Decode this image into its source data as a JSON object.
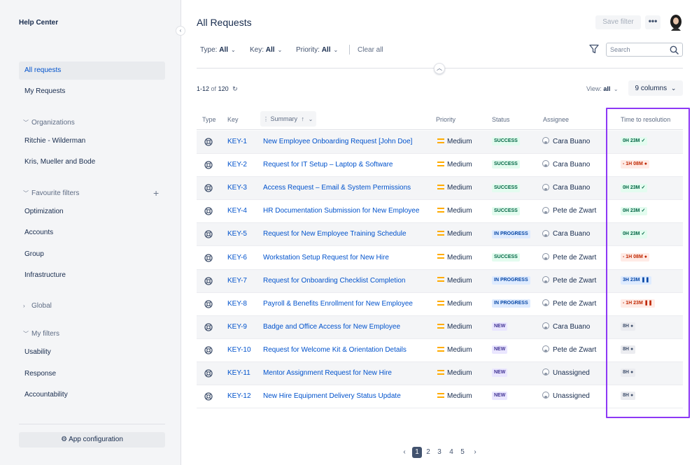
{
  "sidebar": {
    "title": "Help Center",
    "collapse_icon": "chevron-left-icon",
    "main_items": [
      {
        "label": "All requests",
        "active": true
      },
      {
        "label": "My Requests",
        "active": false
      }
    ],
    "sections": [
      {
        "label": "Organizations",
        "expanded": true,
        "items": [
          "Ritchie - Wilderman",
          "Kris, Mueller and Bode"
        ]
      },
      {
        "label": "Favourite filters",
        "expanded": true,
        "items": [
          "Optimization",
          "Accounts",
          "Group",
          "Infrastructure"
        ]
      },
      {
        "label": "Global",
        "expanded": false,
        "items": []
      },
      {
        "label": "My filters",
        "expanded": true,
        "items": [
          "Usability",
          "Response",
          "Accountability"
        ]
      }
    ],
    "app_configuration": "App configuration"
  },
  "header": {
    "title": "All Requests",
    "save_filter": "Save filter",
    "more": "•••"
  },
  "filters": {
    "type_label": "Type:",
    "type_value": "All",
    "key_label": "Key:",
    "key_value": "All",
    "priority_label": "Priority:",
    "priority_value": "All",
    "clear_all": "Clear all",
    "search_placeholder": "Search"
  },
  "results": {
    "range": "1-12",
    "of": "of",
    "total": "120",
    "view_label": "View:",
    "view_value": "all",
    "columns_button": "9 columns"
  },
  "table": {
    "headers": {
      "type": "Type",
      "key": "Key",
      "summary": "Summary",
      "priority": "Priority",
      "status": "Status",
      "assignee": "Assignee",
      "ttr": "Time to resolution"
    },
    "rows": [
      {
        "key": "KEY-1",
        "summary": "New Employee Onboarding Request [John Doe]",
        "priority": "Medium",
        "status": "SUCCESS",
        "assignee": "Cara Buano",
        "ttr": "0H 23M",
        "ttr_state": "ok"
      },
      {
        "key": "KEY-2",
        "summary": "Request for IT Setup – Laptop & Software",
        "priority": "Medium",
        "status": "SUCCESS",
        "assignee": "Cara Buano",
        "ttr": "- 1H 08M",
        "ttr_state": "breached"
      },
      {
        "key": "KEY-3",
        "summary": "Access Request – Email & System Permissions",
        "priority": "Medium",
        "status": "SUCCESS",
        "assignee": "Cara Buano",
        "ttr": "0H 23M",
        "ttr_state": "ok"
      },
      {
        "key": "KEY-4",
        "summary": "HR Documentation Submission for New Employee",
        "priority": "Medium",
        "status": "SUCCESS",
        "assignee": "Pete de Zwart",
        "ttr": "0H 23M",
        "ttr_state": "ok"
      },
      {
        "key": "KEY-5",
        "summary": "Request for New Employee Training Schedule",
        "priority": "Medium",
        "status": "IN PROGRESS",
        "assignee": "Cara Buano",
        "ttr": "0H 23M",
        "ttr_state": "ok"
      },
      {
        "key": "KEY-6",
        "summary": "Workstation Setup Request for New Hire",
        "priority": "Medium",
        "status": "SUCCESS",
        "assignee": "Pete de Zwart",
        "ttr": "- 1H 08M",
        "ttr_state": "breached"
      },
      {
        "key": "KEY-7",
        "summary": "Request for Onboarding Checklist Completion",
        "priority": "Medium",
        "status": "IN PROGRESS",
        "assignee": "Pete de Zwart",
        "ttr": "3H 23M",
        "ttr_state": "paused"
      },
      {
        "key": "KEY-8",
        "summary": "Payroll & Benefits Enrollment for New Employee",
        "priority": "Medium",
        "status": "IN PROGRESS",
        "assignee": "Pete de Zwart",
        "ttr": "- 1H 23M",
        "ttr_state": "breached-paused"
      },
      {
        "key": "KEY-9",
        "summary": "Badge and Office Access for New Employee",
        "priority": "Medium",
        "status": "NEW",
        "assignee": "Cara Buano",
        "ttr": "8H",
        "ttr_state": "pending"
      },
      {
        "key": "KEY-10",
        "summary": "Request for Welcome Kit & Orientation Details",
        "priority": "Medium",
        "status": "NEW",
        "assignee": "Pete de Zwart",
        "ttr": "8H",
        "ttr_state": "pending"
      },
      {
        "key": "KEY-11",
        "summary": "Mentor Assignment Request for New Hire",
        "priority": "Medium",
        "status": "NEW",
        "assignee": "Unassigned",
        "ttr": "8H",
        "ttr_state": "pending"
      },
      {
        "key": "KEY-12",
        "summary": "New Hire Equipment Delivery Status Update",
        "priority": "Medium",
        "status": "NEW",
        "assignee": "Unassigned",
        "ttr": "8H",
        "ttr_state": "pending"
      }
    ]
  },
  "pagination": {
    "pages": [
      "1",
      "2",
      "3",
      "4",
      "5"
    ],
    "current": "1"
  },
  "colors": {
    "link": "#0052cc",
    "priority_medium": "#ffab00",
    "highlight_border": "#8d38f5",
    "success_bg": "#e3fcef",
    "success_fg": "#006644",
    "progress_bg": "#deebff",
    "progress_fg": "#0747a6",
    "new_bg": "#eae6ff",
    "new_fg": "#403294",
    "breached_bg": "#ffebe6",
    "breached_fg": "#bf2600",
    "pending_bg": "#ebecf0",
    "pending_fg": "#42526e"
  }
}
